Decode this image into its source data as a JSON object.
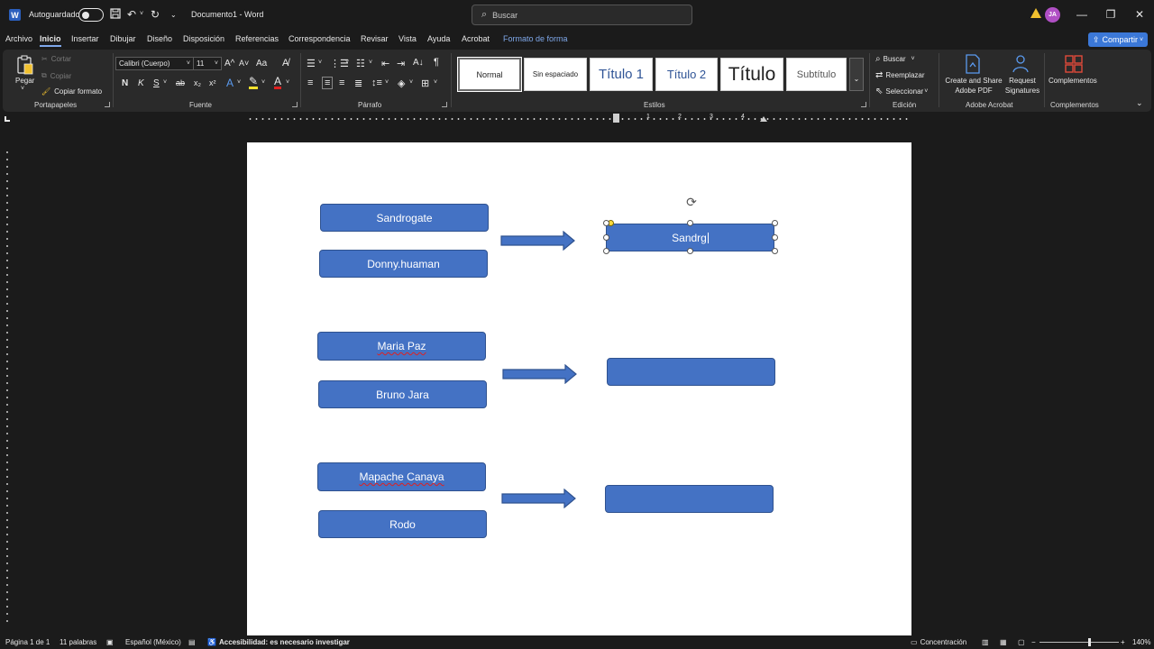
{
  "titlebar": {
    "app_icon": "W",
    "autosave_label": "Autoguardado",
    "doc_title": "Documento1  -  Word",
    "search_placeholder": "Buscar",
    "avatar_initials": "JA",
    "qa_icons": [
      "save-icon",
      "undo-icon",
      "redo-icon",
      "customize-icon"
    ]
  },
  "menu": {
    "tabs": [
      "Archivo",
      "Inicio",
      "Insertar",
      "Dibujar",
      "Diseño",
      "Disposición",
      "Referencias",
      "Correspondencia",
      "Revisar",
      "Vista",
      "Ayuda",
      "Acrobat",
      "Formato de forma"
    ],
    "active_tab": "Inicio",
    "share_label": "Compartir"
  },
  "ribbon": {
    "clipboard": {
      "label": "Portapapeles",
      "paste": "Pegar",
      "cut": "Cortar",
      "copy": "Copiar",
      "format_painter": "Copiar formato"
    },
    "font": {
      "label": "Fuente",
      "font_name": "Calibri (Cuerpo)",
      "font_size": "11",
      "bold": "N",
      "italic": "K",
      "underline": "S",
      "strike": "ab",
      "subscript": "x₂",
      "superscript": "x²",
      "grow": "A^",
      "shrink": "A˅",
      "case": "Aa"
    },
    "paragraph": {
      "label": "Párrafo"
    },
    "styles": {
      "label": "Estilos",
      "items": [
        "Normal",
        "Sin espaciado",
        "Título 1",
        "Título 2",
        "Título",
        "Subtítulo"
      ]
    },
    "editing": {
      "label": "Edición",
      "find": "Buscar",
      "replace": "Reemplazar",
      "select": "Seleccionar"
    },
    "acrobat": {
      "label": "Adobe Acrobat",
      "create_share_line1": "Create and Share",
      "create_share_line2": "Adobe PDF",
      "request_line1": "Request",
      "request_line2": "Signatures"
    },
    "addins": {
      "label": "Complementos",
      "button": "Complementos"
    }
  },
  "ruler": {
    "numbers": [
      "1",
      "1",
      "2",
      "3",
      "4"
    ]
  },
  "document": {
    "left_boxes": [
      "Sandrogate",
      "Donny.huaman",
      "Maria Paz",
      "Bruno Jara",
      "Mapache Canaya",
      "Rodo"
    ],
    "right_boxes": [
      "Sandrg",
      "",
      ""
    ]
  },
  "status": {
    "page": "Página 1 de 1",
    "words": "11 palabras",
    "language": "Español (México)",
    "accessibility": "Accesibilidad: es necesario investigar",
    "focus": "Concentración",
    "zoom": "140%"
  },
  "colors": {
    "shape_fill": "#4472c4",
    "shape_border": "#2f528f",
    "accent": "#3b78d8"
  }
}
